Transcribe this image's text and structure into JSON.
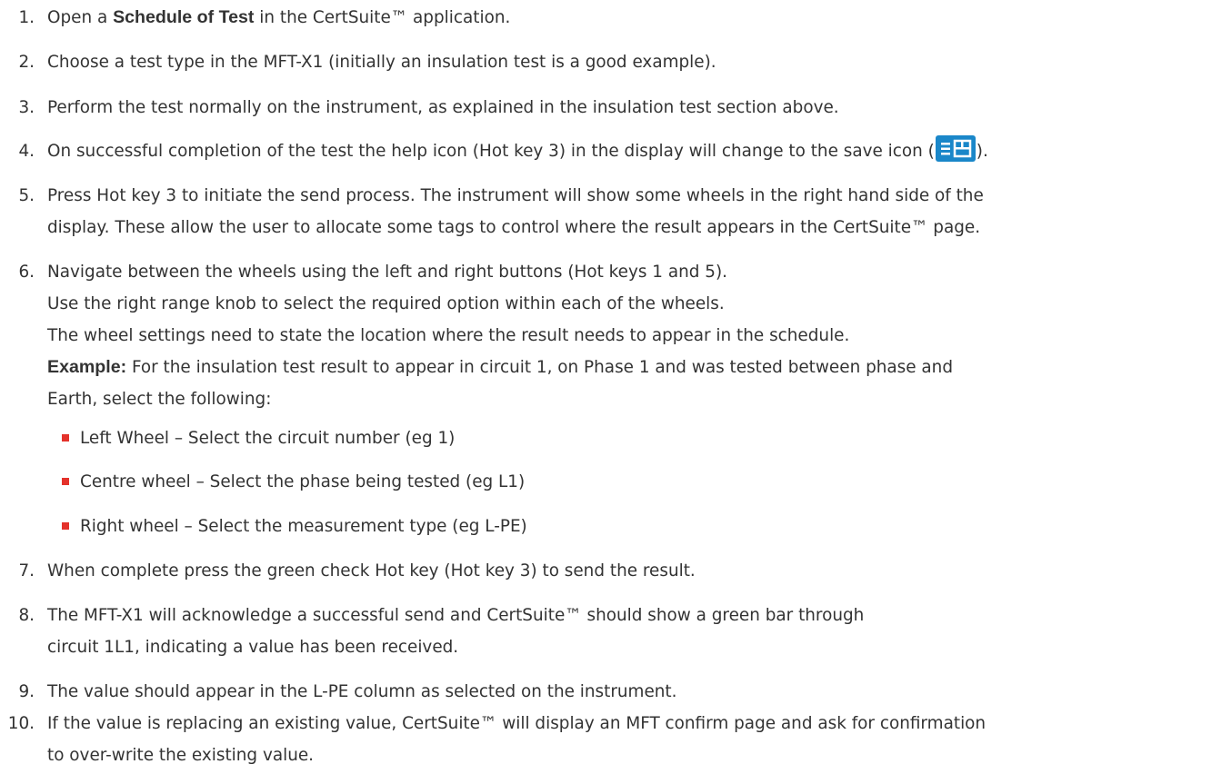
{
  "steps": [
    {
      "num": "1.",
      "parts": {
        "pre": "Open a ",
        "bold": "Schedule of Test",
        "post": " in the CertSuite™ application."
      }
    },
    {
      "num": "2.",
      "text": "Choose a test type in the MFT-X1 (initially an insulation test is a good example)."
    },
    {
      "num": "3.",
      "text": "Perform the test normally on the instrument, as explained in the insulation test section above."
    },
    {
      "num": "4.",
      "parts": {
        "pre": "On successful completion of the test the help icon (Hot key 3) in the display will change to the save icon (",
        "post": ")."
      },
      "icon": "save-icon"
    },
    {
      "num": "5.",
      "lines": [
        "Press Hot key 3 to initiate the send process. The instrument will show some wheels in the right hand side of the",
        "display. These allow the user to allocate some tags to control where the result appears in the CertSuite™ page."
      ]
    },
    {
      "num": "6.",
      "lines": [
        "Navigate between the wheels using the left and right buttons (Hot keys 1 and 5).",
        "Use the right range knob to select the required option within each of the wheels.",
        "The wheel settings need to state the location where the result needs to appear in the schedule."
      ],
      "example_label": "Example:",
      "example_lines": [
        " For the insulation test result to appear in circuit 1, on Phase 1 and was tested between phase and",
        "Earth, select the following:"
      ]
    },
    {
      "num": "7.",
      "text": "When complete press the green check Hot key (Hot key 3) to send the result."
    },
    {
      "num": "8.",
      "lines": [
        "The MFT-X1 will acknowledge a successful send and CertSuite™ should show a green bar through",
        "circuit 1L1, indicating a value has been received."
      ]
    },
    {
      "num": "9.",
      "text": "The value should appear in the L-PE column as selected on the instrument."
    },
    {
      "num": "10.",
      "lines": [
        "If the value is replacing an existing value, CertSuite™ will display an MFT confirm page and ask for confirmation",
        "to over-write the existing value."
      ]
    }
  ],
  "bullets": [
    "Left Wheel – Select the circuit number (eg 1)",
    "Centre wheel – Select the phase being tested (eg L1)",
    "Right wheel – Select the measurement type (eg L-PE)"
  ],
  "colors": {
    "text": "#333333",
    "bullet": "#e4322b",
    "save_icon_bg": "#1a87c9"
  }
}
